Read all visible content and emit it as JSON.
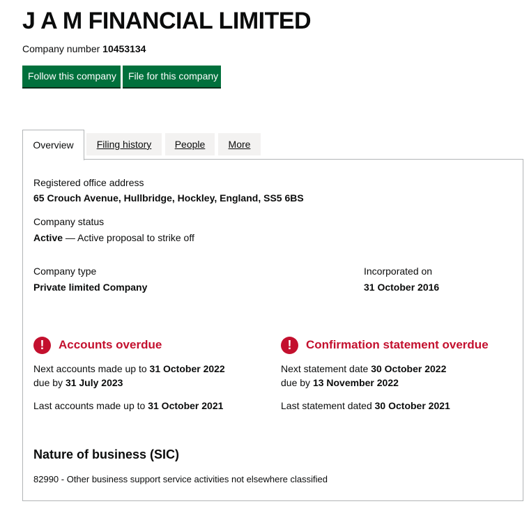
{
  "company": {
    "name": "J A M FINANCIAL LIMITED",
    "number_label": "Company number",
    "number": "10453134"
  },
  "actions": {
    "follow": "Follow this company",
    "file": "File for this company"
  },
  "tabs": [
    {
      "label": "Overview",
      "active": true
    },
    {
      "label": "Filing history",
      "active": false
    },
    {
      "label": "People",
      "active": false
    },
    {
      "label": "More",
      "active": false
    }
  ],
  "overview": {
    "registered_office_label": "Registered office address",
    "registered_office": "65 Crouch Avenue, Hullbridge, Hockley, England, SS5 6BS",
    "status_label": "Company status",
    "status_value": "Active",
    "status_detail": " — Active proposal to strike off",
    "type_label": "Company type",
    "type_value": "Private limited Company",
    "incorporated_label": "Incorporated on",
    "incorporated_value": "31 October 2016"
  },
  "accounts": {
    "title": "Accounts overdue",
    "next_label": "Next accounts made up to ",
    "next_value": "31 October 2022",
    "due_label": "due by ",
    "due_value": "31 July 2023",
    "last_label": "Last accounts made up to ",
    "last_value": "31 October 2021"
  },
  "confirmation": {
    "title": "Confirmation statement overdue",
    "next_label": "Next statement date ",
    "next_value": "30 October 2022",
    "due_label": "due by ",
    "due_value": "13 November 2022",
    "last_label": "Last statement dated ",
    "last_value": "30 October 2021"
  },
  "sic": {
    "heading": "Nature of business (SIC)",
    "items": [
      "82990 - Other business support service activities not elsewhere classified"
    ]
  },
  "icons": {
    "warning": "warning-icon",
    "warning_glyph": "!"
  },
  "colors": {
    "button": "#00703c",
    "warning": "#c3102e",
    "tab_bg": "#f3f2f1",
    "border": "#b1b4b6"
  }
}
